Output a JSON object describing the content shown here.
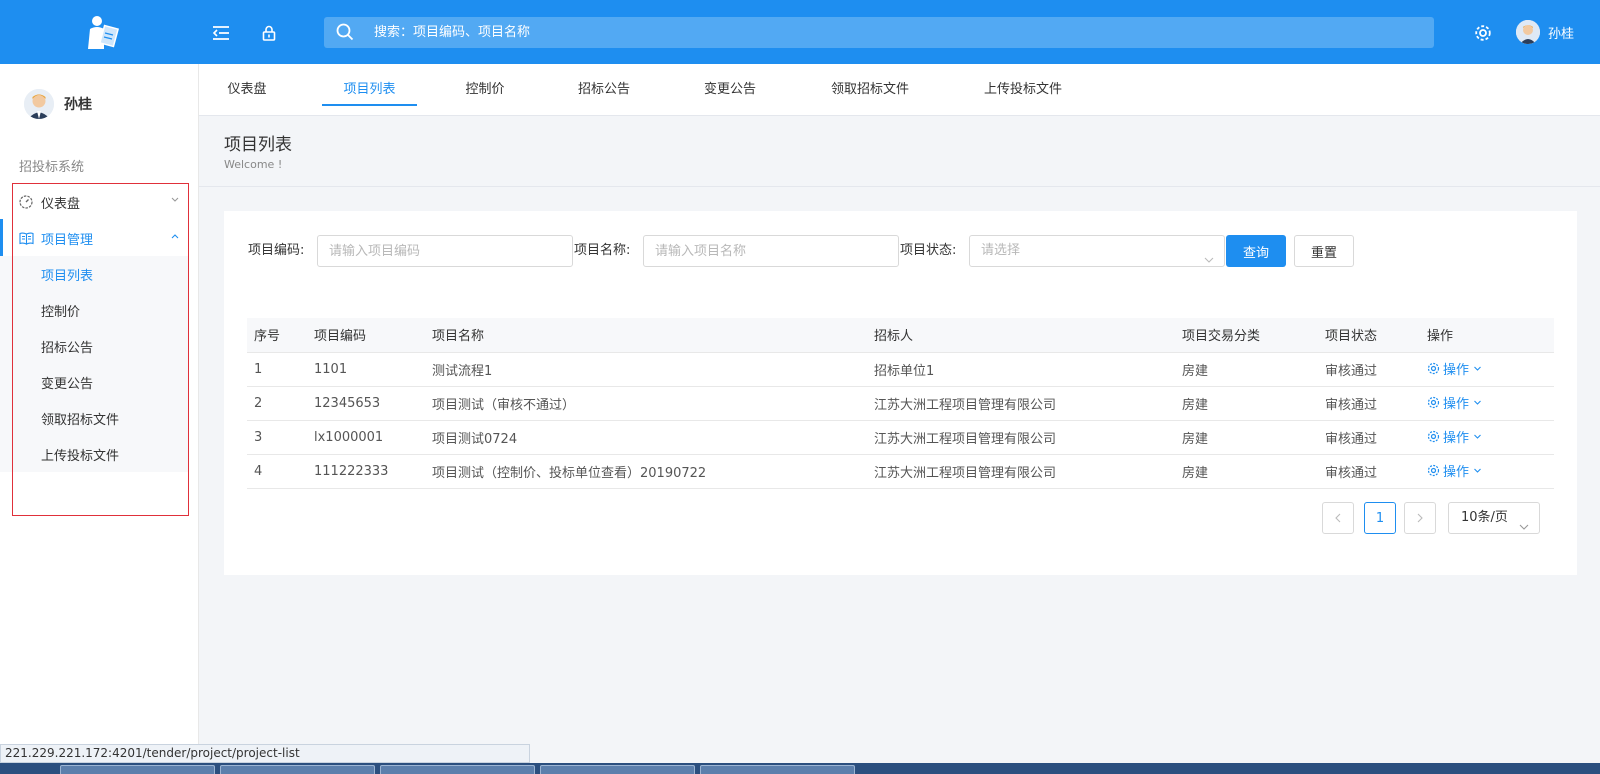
{
  "header": {
    "search_placeholder": "搜索：项目编码、项目名称",
    "user_name": "孙桂"
  },
  "sidebar": {
    "user_name": "孙桂",
    "system_title": "招投标系统",
    "items": [
      {
        "label": "仪表盘",
        "icon": "dashboard-icon"
      },
      {
        "label": "项目管理",
        "icon": "book-icon"
      }
    ],
    "sub_items": [
      "项目列表",
      "控制价",
      "招标公告",
      "变更公告",
      "领取招标文件",
      "上传投标文件"
    ]
  },
  "tabs": [
    "仪表盘",
    "项目列表",
    "控制价",
    "招标公告",
    "变更公告",
    "领取招标文件",
    "上传投标文件"
  ],
  "page": {
    "title": "项目列表",
    "subtitle": "Welcome !"
  },
  "filters": {
    "code_label": "项目编码:",
    "code_placeholder": "请输入项目编码",
    "name_label": "项目名称:",
    "name_placeholder": "请输入项目名称",
    "status_label": "项目状态:",
    "status_placeholder": "请选择",
    "query_button": "查询",
    "reset_button": "重置"
  },
  "table": {
    "headers": [
      "序号",
      "项目编码",
      "项目名称",
      "招标人",
      "项目交易分类",
      "项目状态",
      "操作"
    ],
    "rows": [
      {
        "no": "1",
        "code": "1101",
        "name": "测试流程1",
        "tenderer": "招标单位1",
        "category": "房建",
        "status": "审核通过",
        "action": "操作"
      },
      {
        "no": "2",
        "code": "12345653",
        "name": "项目测试（审核不通过）",
        "tenderer": "江苏大洲工程项目管理有限公司",
        "category": "房建",
        "status": "审核通过",
        "action": "操作"
      },
      {
        "no": "3",
        "code": "lx1000001",
        "name": "项目测试0724",
        "tenderer": "江苏大洲工程项目管理有限公司",
        "category": "房建",
        "status": "审核通过",
        "action": "操作"
      },
      {
        "no": "4",
        "code": "111222333",
        "name": "项目测试（控制价、投标单位查看）20190722",
        "tenderer": "江苏大洲工程项目管理有限公司",
        "category": "房建",
        "status": "审核通过",
        "action": "操作"
      }
    ]
  },
  "pagination": {
    "current_page": "1",
    "page_size": "10条/页"
  },
  "statusbar": {
    "url": "221.229.221.172:4201/tender/project/project-list"
  },
  "colors": {
    "primary": "#1e8ef0",
    "highlight_box": "#e0303a"
  }
}
